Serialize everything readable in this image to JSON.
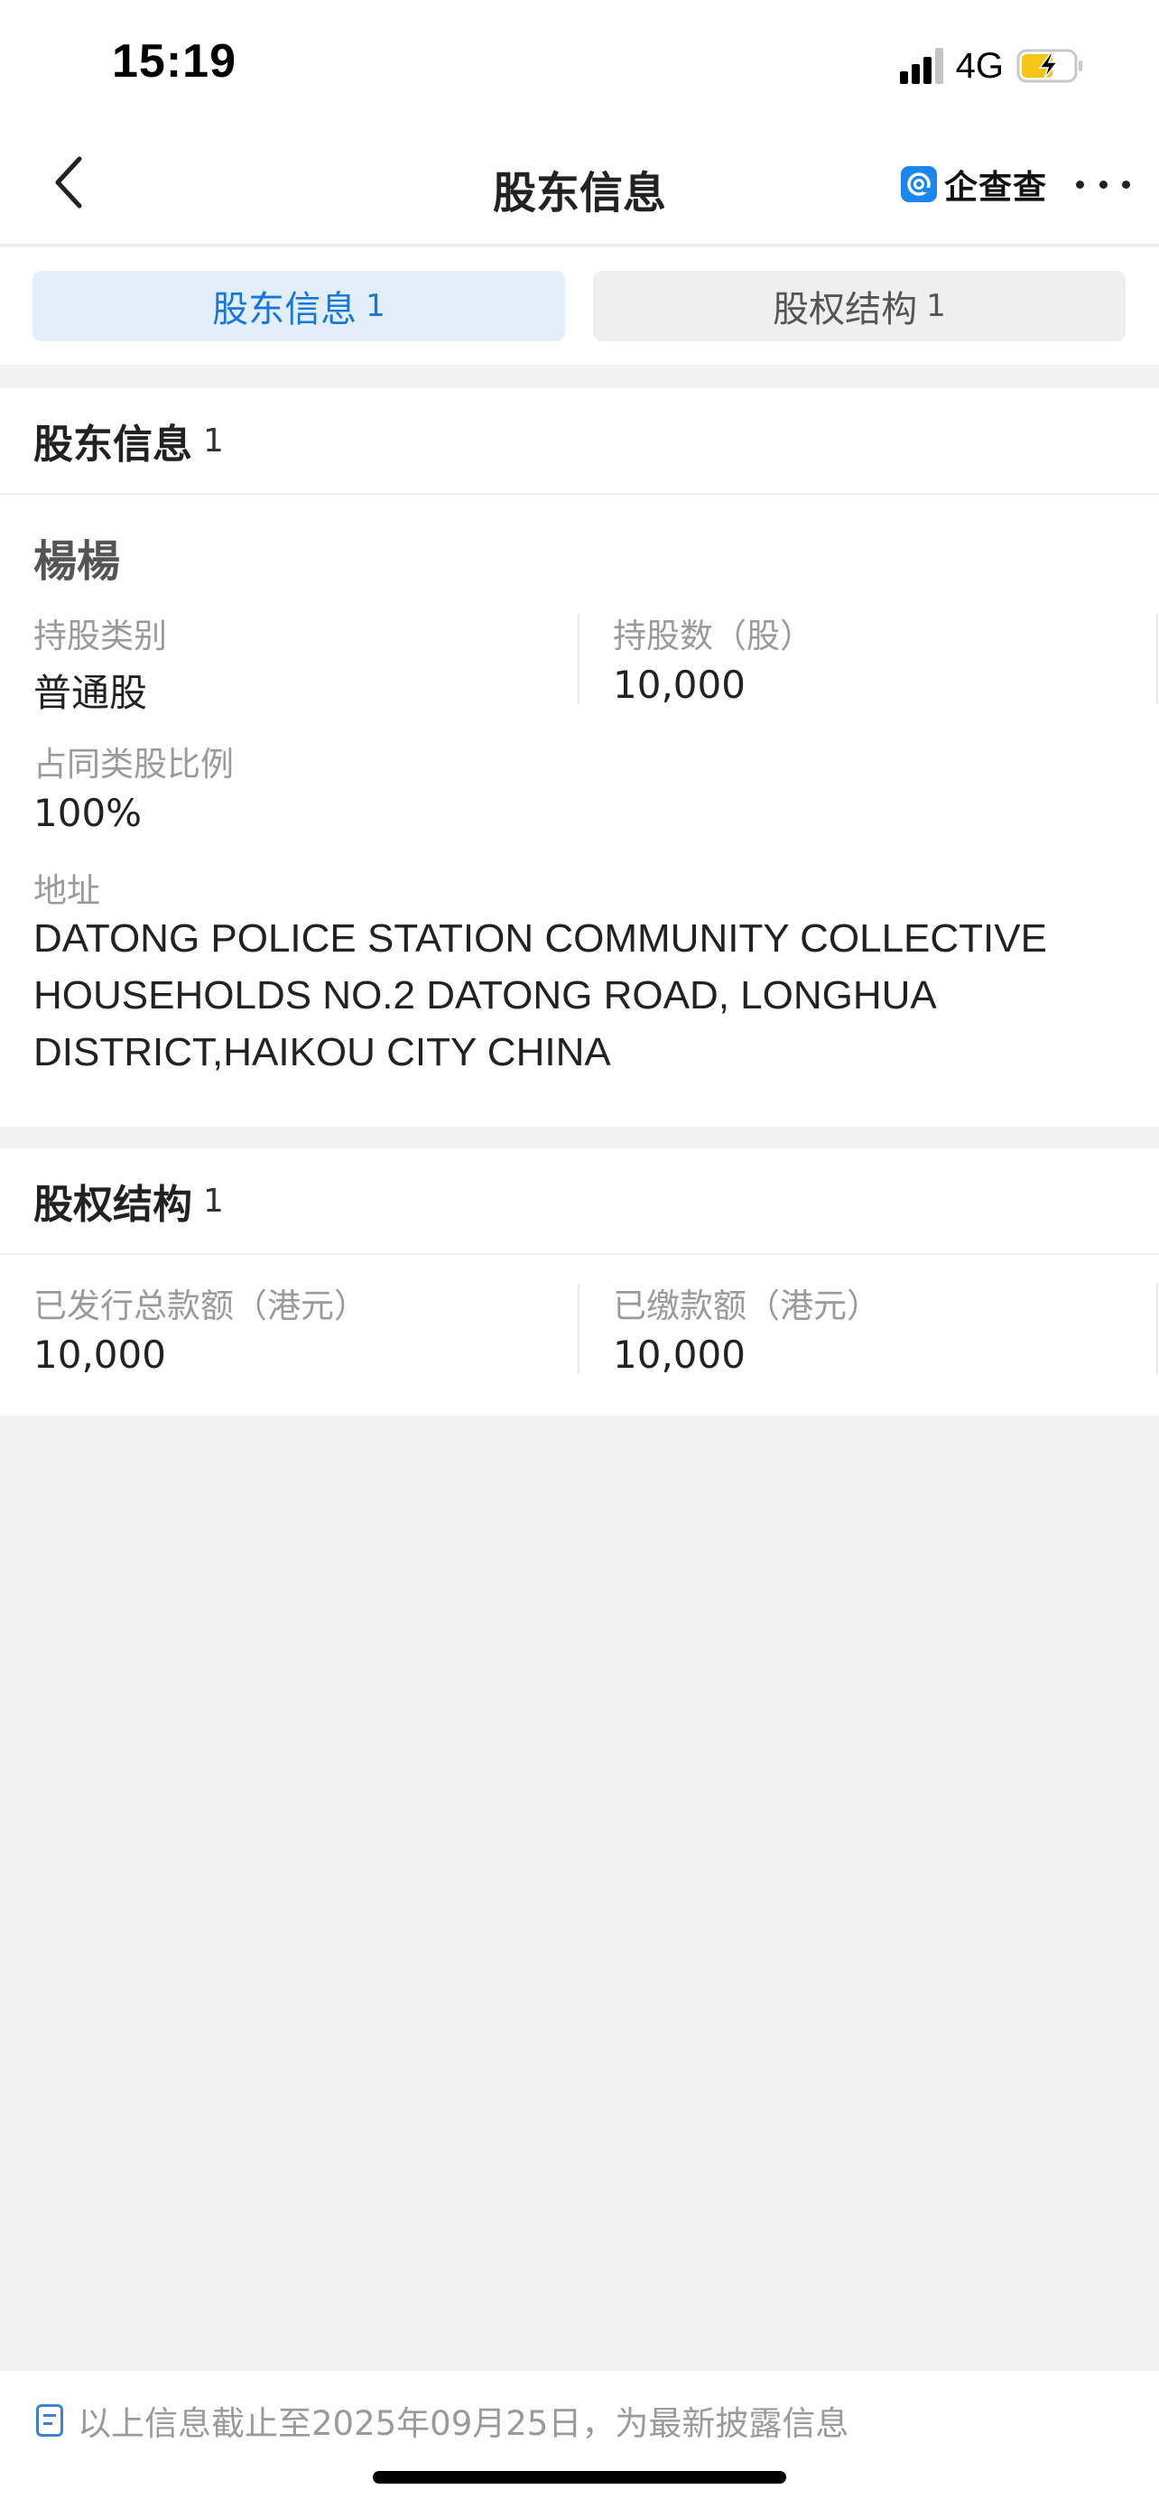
{
  "status_bar": {
    "time": "15:19",
    "network": "4G",
    "battery_charging": true,
    "battery_color": "#f5c518"
  },
  "nav": {
    "title": "股东信息",
    "brand_name": "企查查",
    "brand_color": "#1b86ee",
    "back_icon": "chevron-left-icon",
    "more_icon": "more-dots-icon"
  },
  "tabs": [
    {
      "label": "股东信息",
      "count": "1",
      "active": true
    },
    {
      "label": "股权结构",
      "count": "1",
      "active": false
    }
  ],
  "shareholder_section": {
    "title": "股东信息",
    "count": "1",
    "holder": {
      "name": "楊楊",
      "share_class_label": "持股类别",
      "share_class_value": "普通股",
      "share_count_label": "持股数（股）",
      "share_count_value": "10,000",
      "ratio_label": "占同类股比例",
      "ratio_value": "100%",
      "address_label": "地址",
      "address_value": "DATONG POLICE STATION COMMUNITY COLLECTIVE HOUSEHOLDS NO.2 DATONG ROAD, LONGHUA DISTRICT,HAIKOU CITY CHINA"
    }
  },
  "equity_section": {
    "title": "股权结构",
    "count": "1",
    "issued_label": "已发行总款额（港元）",
    "issued_value": "10,000",
    "paid_label": "已缴款额（港元）",
    "paid_value": "10,000"
  },
  "footer": {
    "note": "以上信息截止至2025年09月25日，为最新披露信息",
    "accent_color": "#3b82d6"
  }
}
